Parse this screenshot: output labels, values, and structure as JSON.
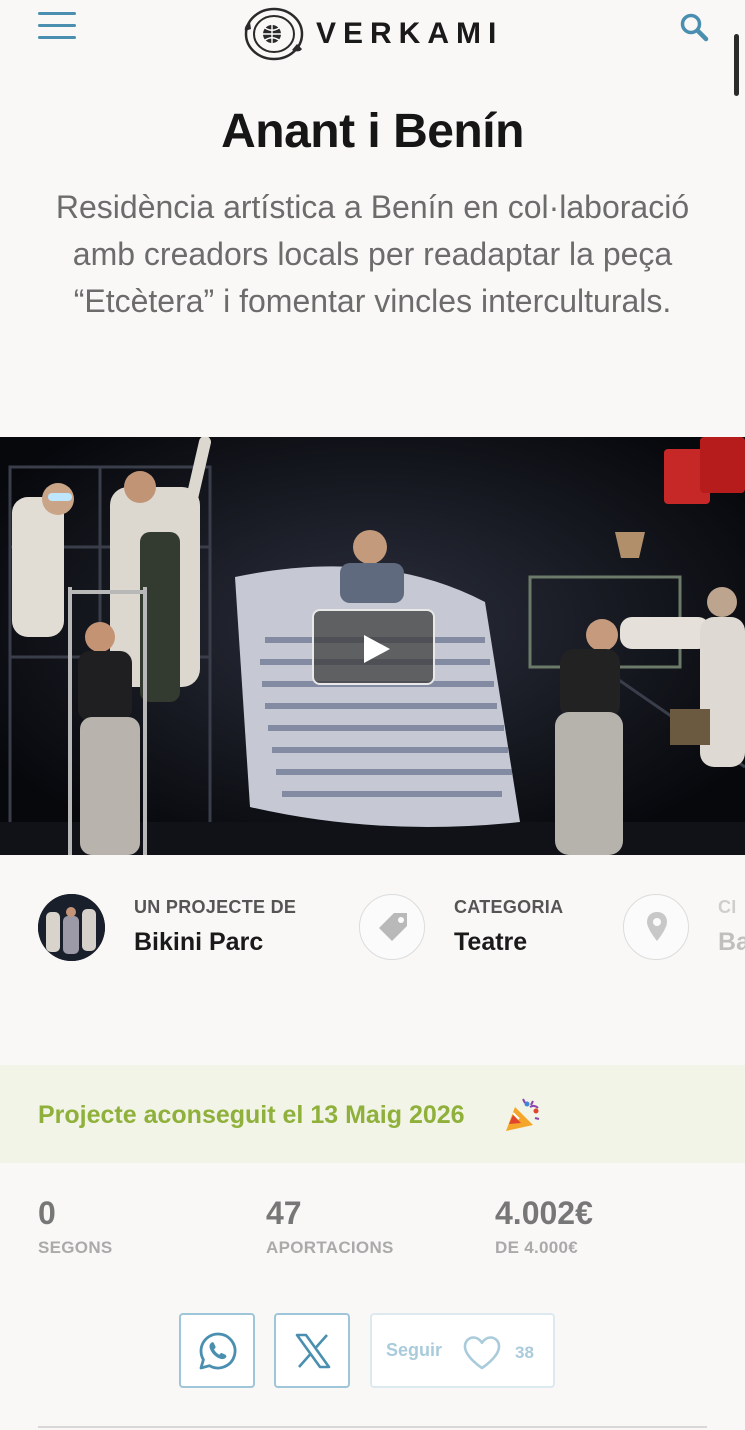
{
  "header": {
    "brand": "VERKAMI",
    "menu_icon": "hamburger-menu-icon",
    "search_icon": "search-icon",
    "accent_color": "#4a8fb0"
  },
  "project": {
    "title": "Anant i Benín",
    "subtitle": "Residència artística a Benín en col·laboració amb creadors locals per readaptar la peça “Etcètera” i fomentar vincles interculturals."
  },
  "video": {
    "play_icon": "play-icon"
  },
  "info": {
    "author_label": "UN PROJECTE DE",
    "author_name": "Bikini Parc",
    "category_label": "CATEGORIA",
    "category_value": "Teatre",
    "category_icon": "tag-icon",
    "location_label": "CI",
    "location_value": "Ba",
    "location_icon": "map-pin-icon"
  },
  "banner": {
    "text": "Projecte aconseguit el 13 Maig 2026",
    "icon": "party-popper-icon",
    "color": "#8fb03a"
  },
  "stats": [
    {
      "value": "0",
      "label": "SEGONS"
    },
    {
      "value": "47",
      "label": "APORTACIONS"
    },
    {
      "value": "4.002€",
      "label": "DE 4.000€"
    }
  ],
  "actions": {
    "whatsapp_icon": "whatsapp-icon",
    "x_icon": "x-twitter-icon",
    "follow_label": "Seguir",
    "follow_icon": "heart-icon",
    "follow_count": "38"
  }
}
